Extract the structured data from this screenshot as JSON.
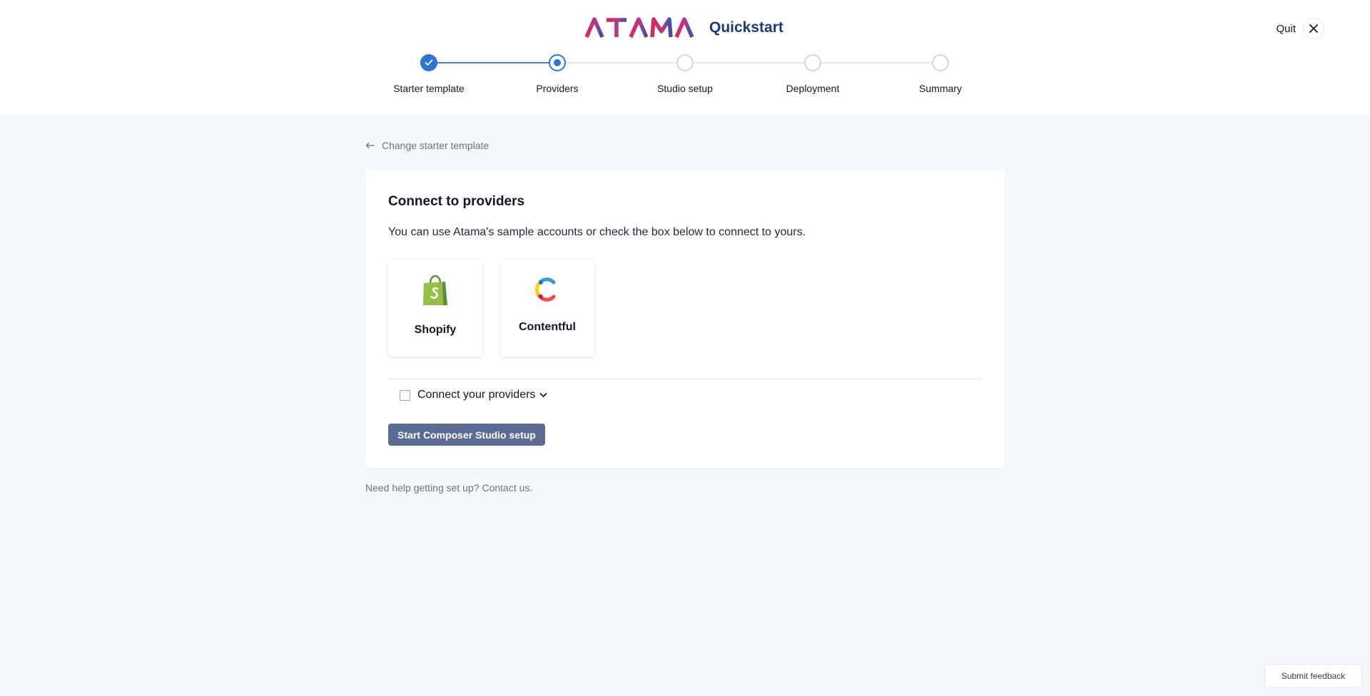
{
  "header": {
    "brand_logo_text": "ATAMA",
    "product": "Quickstart",
    "quit_label": "Quit",
    "colors": {
      "logo_gradient_start": "#e02459",
      "logo_gradient_end": "#3a4fa8",
      "product_text": "#1e3a7b"
    }
  },
  "stepper": {
    "steps": [
      {
        "label": "Starter template",
        "state": "complete"
      },
      {
        "label": "Providers",
        "state": "current"
      },
      {
        "label": "Studio setup",
        "state": "upcoming"
      },
      {
        "label": "Deployment",
        "state": "upcoming"
      },
      {
        "label": "Summary",
        "state": "upcoming"
      }
    ],
    "accent": "#2f74d0"
  },
  "back_link": {
    "label": "Change starter template",
    "icon": "arrow-left-icon"
  },
  "card": {
    "title": "Connect to providers",
    "description": "You can use Atama's sample accounts or check the box below to connect to yours.",
    "providers": [
      {
        "label": "Shopify",
        "icon": "shopify-icon"
      },
      {
        "label": "Contentful",
        "icon": "contentful-icon"
      }
    ],
    "connect_toggle": {
      "label": "Connect your providers",
      "checked": false,
      "icon": "chevron-down-icon"
    },
    "primary_button": {
      "label": "Start Composer Studio setup",
      "color": "#5b6b94"
    }
  },
  "help_text": "Need help getting set up? Contact us.",
  "feedback_button": "Submit feedback"
}
